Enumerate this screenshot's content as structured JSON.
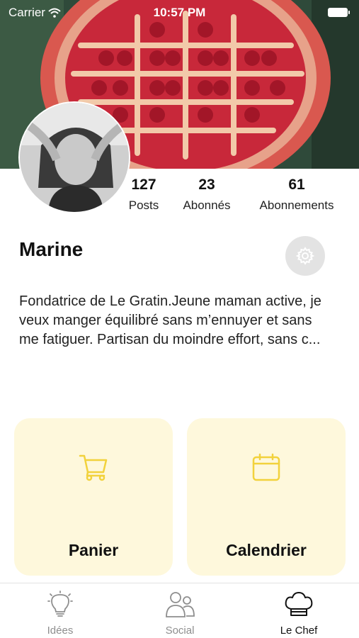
{
  "status_bar": {
    "carrier": "Carrier",
    "time": "10:57 PM"
  },
  "profile": {
    "name": "Marine",
    "bio": "Fondatrice de Le Gratin.Jeune maman active, je veux manger équilibré sans m’ennuyer et sans me fatiguer. Partisan du moindre effort, sans c...",
    "stats": [
      {
        "value": "127",
        "label": "Posts"
      },
      {
        "value": "23",
        "label": "Abonnés"
      },
      {
        "value": "61",
        "label": "Abonnements"
      }
    ]
  },
  "cards": [
    {
      "label": "Panier",
      "icon": "cart-icon"
    },
    {
      "label": "Calendrier",
      "icon": "calendar-icon"
    }
  ],
  "tabs": [
    {
      "label": "Idées",
      "icon": "lightbulb-icon",
      "active": false
    },
    {
      "label": "Social",
      "icon": "people-icon",
      "active": false
    },
    {
      "label": "Le Chef",
      "icon": "chef-hat-icon",
      "active": true
    }
  ],
  "colors": {
    "accent": "#f2d23c",
    "card_bg": "#fef8dc",
    "tab_inactive": "#8e8e8e"
  }
}
